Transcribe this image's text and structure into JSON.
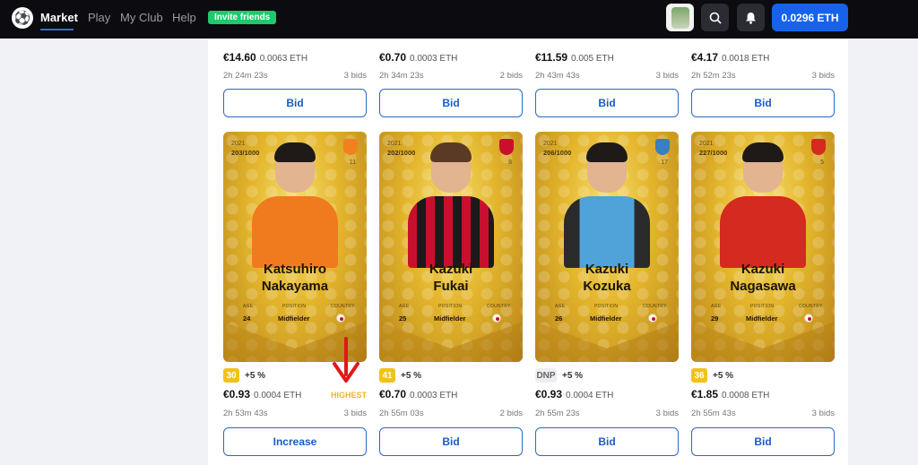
{
  "nav": {
    "items": [
      {
        "label": "Market",
        "active": true
      },
      {
        "label": "Play"
      },
      {
        "label": "My Club"
      },
      {
        "label": "Help"
      }
    ],
    "invite_label": "Invite friends",
    "wallet_label": "0.0296 ETH"
  },
  "top_row": [
    {
      "price": "€14.60",
      "eth": "0.0063 ETH",
      "time": "2h 24m 23s",
      "bids": "3 bids",
      "button": "Bid"
    },
    {
      "price": "€0.70",
      "eth": "0.0003 ETH",
      "time": "2h 34m 23s",
      "bids": "2 bids",
      "button": "Bid"
    },
    {
      "price": "€11.59",
      "eth": "0.005 ETH",
      "time": "2h 43m 43s",
      "bids": "3 bids",
      "button": "Bid"
    },
    {
      "price": "€4.17",
      "eth": "0.0018 ETH",
      "time": "2h 52m 23s",
      "bids": "3 bids",
      "button": "Bid"
    }
  ],
  "cards": [
    {
      "season": "2021",
      "serial": "203/1000",
      "club_number": "11",
      "first_name": "Katsuhiro",
      "last_name": "Nakayama",
      "stat_labels": [
        "AGE",
        "POSITION",
        "COUNTRY"
      ],
      "age": "24",
      "position": "Midfielder",
      "score": "30",
      "bonus": "+5 %",
      "price": "€0.93",
      "eth": "0.0004 ETH",
      "status": "HIGHEST",
      "time": "2h 53m 43s",
      "bids": "3 bids",
      "button": "Increase",
      "jersey_color": "#f07a1e",
      "club_color": "#f0811e"
    },
    {
      "season": "2021",
      "serial": "202/1000",
      "club_number": "8",
      "first_name": "Kazuki",
      "last_name": "Fukai",
      "stat_labels": [
        "AGE",
        "POSITION",
        "COUNTRY"
      ],
      "age": "25",
      "position": "Midfielder",
      "score": "41",
      "bonus": "+5 %",
      "price": "€0.70",
      "eth": "0.0003 ETH",
      "time": "2h 55m 03s",
      "bids": "2 bids",
      "button": "Bid",
      "jersey_color": "#c8102e",
      "club_color": "#c8102e"
    },
    {
      "season": "2021",
      "serial": "206/1000",
      "club_number": "17",
      "first_name": "Kazuki",
      "last_name": "Kozuka",
      "stat_labels": [
        "AGE",
        "POSITION",
        "COUNTRY"
      ],
      "age": "26",
      "position": "Midfielder",
      "score": "DNP",
      "bonus": "+5 %",
      "price": "€0.93",
      "eth": "0.0004 ETH",
      "time": "2h 55m 23s",
      "bids": "3 bids",
      "button": "Bid",
      "jersey_color": "#4fa3d8",
      "club_color": "#3a7fc0"
    },
    {
      "season": "2021",
      "serial": "227/1000",
      "club_number": "5",
      "first_name": "Kazuki",
      "last_name": "Nagasawa",
      "stat_labels": [
        "AGE",
        "POSITION",
        "COUNTRY"
      ],
      "age": "29",
      "position": "Midfielder",
      "score": "36",
      "bonus": "+5 %",
      "price": "€1.85",
      "eth": "0.0008 ETH",
      "time": "2h 55m 43s",
      "bids": "3 bids",
      "button": "Bid",
      "jersey_color": "#d42a1f",
      "club_color": "#d42a1f"
    }
  ],
  "colors": {
    "accent": "#1663ea",
    "highest": "#f2b233",
    "score_yellow": "#f2c21a",
    "invite_green": "#1ec96b"
  }
}
